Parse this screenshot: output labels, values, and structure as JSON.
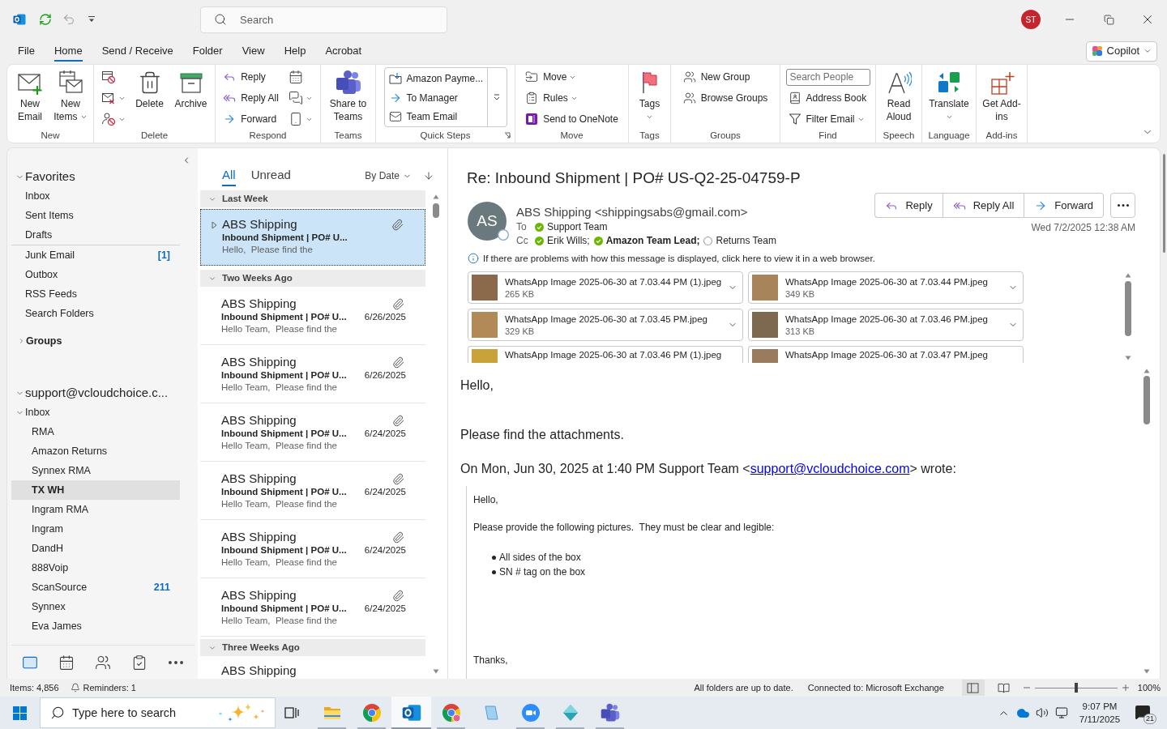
{
  "title_bar": {
    "search": {
      "placeholder": "Search"
    },
    "account_initials": "ST"
  },
  "menu_tabs": [
    {
      "label": "File",
      "selected": false
    },
    {
      "label": "Home",
      "selected": true
    },
    {
      "label": "Send / Receive",
      "selected": false
    },
    {
      "label": "Folder",
      "selected": false
    },
    {
      "label": "View",
      "selected": false
    },
    {
      "label": "Help",
      "selected": false
    },
    {
      "label": "Acrobat",
      "selected": false
    }
  ],
  "copilot": {
    "label": "Copilot"
  },
  "ribbon": {
    "groups": [
      {
        "label": "New",
        "items": [
          {
            "kind": "large",
            "label": "New Email",
            "dropdown": false
          },
          {
            "kind": "large",
            "label": "New Items",
            "dropdown": true
          }
        ]
      },
      {
        "label": "Delete",
        "items": [
          {
            "kind": "icon",
            "dropdown": false
          },
          {
            "kind": "icon",
            "dropdown": true
          },
          {
            "kind": "icon",
            "dropdown": true
          },
          {
            "kind": "large",
            "label": "Delete",
            "dropdown": false
          },
          {
            "kind": "large",
            "label": "Archive",
            "dropdown": false
          }
        ]
      },
      {
        "label": "Respond",
        "items": [
          {
            "kind": "small",
            "label": "Reply",
            "dropdown": false
          },
          {
            "kind": "small",
            "label": "Reply All",
            "dropdown": false
          },
          {
            "kind": "small",
            "label": "Forward",
            "dropdown": false
          },
          {
            "kind": "icon",
            "dropdown": false
          },
          {
            "kind": "icon",
            "dropdown": true
          },
          {
            "kind": "icon",
            "dropdown": true
          }
        ]
      },
      {
        "label": "Teams",
        "items": [
          {
            "kind": "large",
            "label": "Share to Teams",
            "dropdown": false
          }
        ]
      },
      {
        "label": "Quick Steps",
        "launcher": true,
        "items": [
          {
            "kind": "gallery",
            "entries": [
              "Amazon Payme...",
              "To Manager",
              "Team Email"
            ]
          }
        ]
      },
      {
        "label": "Move",
        "items": [
          {
            "kind": "small",
            "label": "Move",
            "dropdown": true
          },
          {
            "kind": "small",
            "label": "Rules",
            "dropdown": true
          },
          {
            "kind": "small",
            "label": "Send to OneNote",
            "dropdown": false
          }
        ]
      },
      {
        "label": "Tags",
        "items": [
          {
            "kind": "large",
            "label": "Tags",
            "dropdown": true
          }
        ]
      },
      {
        "label": "Groups",
        "items": [
          {
            "kind": "small",
            "label": "New Group",
            "dropdown": false
          },
          {
            "kind": "small",
            "label": "Browse Groups",
            "dropdown": false
          }
        ]
      },
      {
        "label": "Find",
        "items": [
          {
            "kind": "search",
            "placeholder": "Search People"
          },
          {
            "kind": "small",
            "label": "Address Book",
            "dropdown": false
          },
          {
            "kind": "small",
            "label": "Filter Email",
            "dropdown": true
          }
        ]
      },
      {
        "label": "Speech",
        "items": [
          {
            "kind": "large",
            "label": "Read Aloud",
            "dropdown": false
          }
        ]
      },
      {
        "label": "Language",
        "items": [
          {
            "kind": "large",
            "label": "Translate",
            "dropdown": true
          }
        ]
      },
      {
        "label": "Add-ins",
        "items": [
          {
            "kind": "large",
            "label": "Get Add-ins",
            "dropdown": false
          }
        ]
      }
    ]
  },
  "nav_pane": {
    "favorites": {
      "label": "Favorites",
      "expanded": true,
      "folders": [
        {
          "label": "Inbox",
          "selected": false
        },
        {
          "label": "Sent Items",
          "selected": false
        },
        {
          "label": "Drafts",
          "selected": false
        }
      ]
    },
    "folders": [
      {
        "label": "Junk Email",
        "count": "[1]",
        "selected": false
      },
      {
        "label": "Outbox",
        "selected": false
      },
      {
        "label": "RSS Feeds",
        "selected": false
      },
      {
        "label": "Search Folders",
        "selected": false
      }
    ],
    "groups": {
      "label": "Groups",
      "expanded": false
    },
    "account": {
      "label": "support@vcloudchoice.c...",
      "expanded": true,
      "folders": [
        {
          "label": "Inbox",
          "expanded": true,
          "selected": false,
          "children": [
            {
              "label": "RMA",
              "selected": false
            },
            {
              "label": "Amazon Returns",
              "selected": false
            },
            {
              "label": "Synnex RMA",
              "selected": false
            },
            {
              "label": "TX WH",
              "selected": true
            },
            {
              "label": "Ingram RMA",
              "selected": false
            },
            {
              "label": "Ingram",
              "selected": false
            },
            {
              "label": "DandH",
              "selected": false
            },
            {
              "label": "888Voip",
              "selected": false
            },
            {
              "label": "ScanSource",
              "count": "211",
              "selected": false
            },
            {
              "label": "Synnex",
              "selected": false
            },
            {
              "label": "Eva James",
              "selected": false
            }
          ]
        }
      ]
    },
    "modules": [
      {
        "selected": true
      },
      {
        "selected": false
      },
      {
        "selected": false
      },
      {
        "selected": false
      },
      {
        "selected": false
      }
    ]
  },
  "message_list": {
    "filters": [
      {
        "label": "All",
        "selected": true
      },
      {
        "label": "Unread",
        "selected": false
      }
    ],
    "sort": {
      "label": "By Date"
    },
    "groups": [
      {
        "label": "Last Week",
        "expanded": true,
        "messages": [
          {
            "sender": "ABS Shipping",
            "subject": "Inbound Shipment | PO# U...",
            "preview": "Hello,  Please find the",
            "attachment": true,
            "thread": true,
            "selected": true
          }
        ]
      },
      {
        "label": "Two Weeks Ago",
        "expanded": true,
        "messages": [
          {
            "sender": "ABS Shipping",
            "subject": "Inbound Shipment | PO# U...",
            "preview": "Hello Team,  Please find the",
            "date": "6/26/2025",
            "attachment": true,
            "thread": false,
            "selected": false
          },
          {
            "sender": "ABS Shipping",
            "subject": "Inbound Shipment | PO# U...",
            "preview": "Hello Team,  Please find the",
            "date": "6/26/2025",
            "attachment": true,
            "thread": false,
            "selected": false
          },
          {
            "sender": "ABS Shipping",
            "subject": "Inbound Shipment | PO# U...",
            "preview": "Hello Team,  Please find the",
            "date": "6/24/2025",
            "attachment": true,
            "thread": false,
            "selected": false
          },
          {
            "sender": "ABS Shipping",
            "subject": "Inbound Shipment | PO# U...",
            "preview": "Hello Team,  Please find the",
            "date": "6/24/2025",
            "attachment": true,
            "thread": false,
            "selected": false
          },
          {
            "sender": "ABS Shipping",
            "subject": "Inbound Shipment | PO# U...",
            "preview": "Hello Team,  Please find the",
            "date": "6/24/2025",
            "attachment": true,
            "thread": false,
            "selected": false
          },
          {
            "sender": "ABS Shipping",
            "subject": "Inbound Shipment | PO# U...",
            "preview": "Hello Team,  Please find the",
            "date": "6/24/2025",
            "attachment": true,
            "thread": false,
            "selected": false
          }
        ]
      },
      {
        "label": "Three Weeks Ago",
        "expanded": true,
        "messages": [
          {
            "sender": "ABS Shipping",
            "selected": false
          }
        ]
      }
    ]
  },
  "reading_pane": {
    "subject": "Re: Inbound Shipment | PO# US-Q2-25-04759-P",
    "sender": {
      "initials": "AS",
      "display": "ABS Shipping <shippingsabs@gmail.com>",
      "available": false
    },
    "to": {
      "label": "To",
      "recipients": [
        {
          "name": "Support Team",
          "available": true,
          "bold": false
        }
      ]
    },
    "cc": {
      "label": "Cc",
      "recipients": [
        {
          "name": "Erik Wills;",
          "available": true,
          "bold": false
        },
        {
          "name": "Amazon Team Lead;",
          "available": true,
          "bold": true
        },
        {
          "name": "Returns Team",
          "available": false,
          "bold": false
        }
      ]
    },
    "actions": [
      {
        "label": "Reply"
      },
      {
        "label": "Reply All"
      },
      {
        "label": "Forward"
      }
    ],
    "date": "Wed 7/2/2025 12:38 AM",
    "info": "If there are problems with how this message is displayed, click here to view it in a web browser.",
    "attachments": [
      {
        "name": "WhatsApp Image 2025-06-30 at 7.03.44 PM (1).jpeg",
        "size": "265 KB"
      },
      {
        "name": "WhatsApp Image 2025-06-30 at 7.03.44 PM.jpeg",
        "size": "349 KB"
      },
      {
        "name": "WhatsApp Image 2025-06-30 at 7.03.45 PM.jpeg",
        "size": "329 KB"
      },
      {
        "name": "WhatsApp Image 2025-06-30 at 7.03.46 PM.jpeg",
        "size": "313 KB"
      },
      {
        "name": "WhatsApp Image 2025-06-30 at 7.03.46 PM (1).jpeg"
      },
      {
        "name": "WhatsApp Image 2025-06-30 at 7.03.47 PM.jpeg"
      }
    ],
    "body": {
      "paragraphs": [
        "Hello,",
        "Please find the attachments."
      ],
      "quote_intro": {
        "text": "On Mon, Jun 30, 2025 at 1:40 PM Support Team <",
        "link": "support@vcloudchoice.com",
        "after": "> wrote:"
      },
      "quote": {
        "greeting": "Hello,",
        "request": "Please provide the following pictures.  They must be clear and legible:",
        "bullets": [
          "All sides of the box",
          "SN # tag on the box"
        ],
        "closing": "Thanks,"
      }
    }
  },
  "status_bar": {
    "items": "Items: 4,856",
    "reminders": "Reminders: 1",
    "sync": "All folders are up to date.",
    "connection": "Connected to: Microsoft Exchange",
    "views": [
      {
        "selected": true
      },
      {
        "selected": false
      }
    ],
    "zoom": {
      "level": 0.5,
      "label": "100%"
    }
  },
  "taskbar": {
    "search": {
      "placeholder": "Type here to search"
    },
    "apps": [
      {
        "running": true,
        "selected": false
      },
      {
        "running": true,
        "selected": false
      },
      {
        "running": true,
        "selected": true
      },
      {
        "running": true,
        "selected": false
      },
      {
        "running": false,
        "selected": false
      },
      {
        "running": true,
        "selected": false
      },
      {
        "running": true,
        "selected": false
      },
      {
        "running": true,
        "selected": false
      }
    ],
    "clock": {
      "time": "9:07 PM",
      "date": "7/11/2025"
    },
    "notifications": "21"
  }
}
